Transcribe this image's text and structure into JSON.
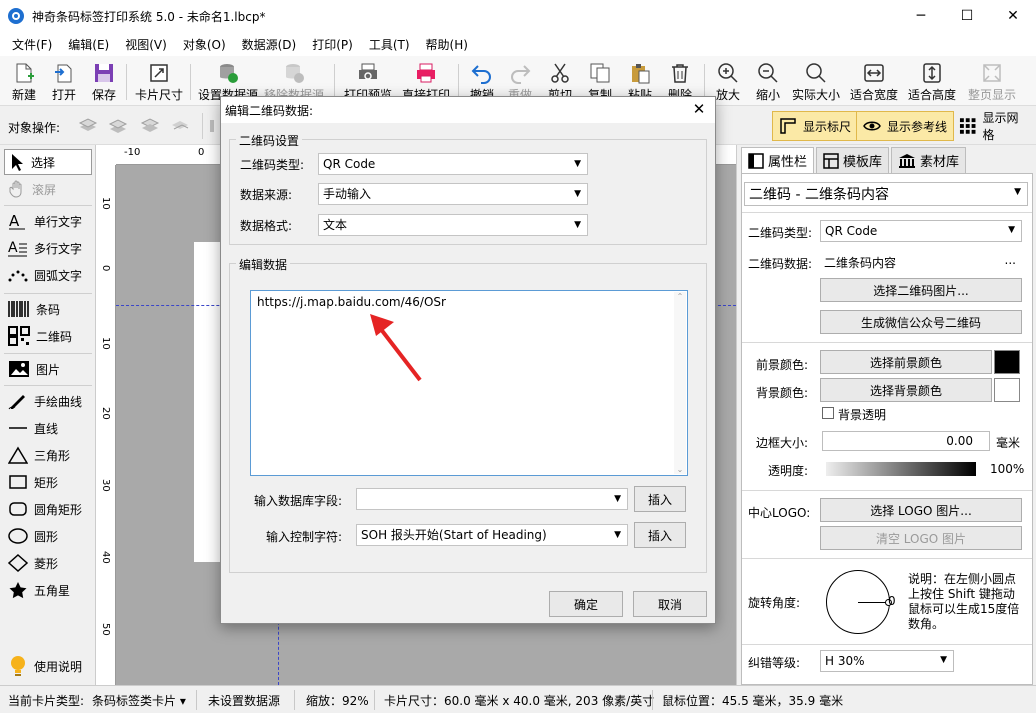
{
  "window": {
    "title": "神奇条码标签打印系统 5.0 - 未命名1.lbcp*",
    "minimize": "─",
    "maximize": "☐",
    "close": "✕"
  },
  "menu": [
    "文件(F)",
    "编辑(E)",
    "视图(V)",
    "对象(O)",
    "数据源(D)",
    "打印(P)",
    "工具(T)",
    "帮助(H)"
  ],
  "toolbar": {
    "new": "新建",
    "open": "打开",
    "save": "保存",
    "card_size": "卡片尺寸",
    "set_datasource": "设置数据源",
    "remove_datasource": "移除数据源",
    "print_preview": "打印预览",
    "direct_print": "直接打印",
    "undo": "撤销",
    "redo": "重做",
    "cut": "剪切",
    "copy": "复制",
    "paste": "粘贴",
    "delete": "删除",
    "zoom_in": "放大",
    "zoom_out": "缩小",
    "actual_size": "实际大小",
    "fit_width": "适合宽度",
    "fit_height": "适合高度",
    "fit_page": "整页显示"
  },
  "objbar": {
    "label": "对象操作:",
    "show_ruler": "显示标尺",
    "show_guides": "显示参考线",
    "show_grid": "显示网格"
  },
  "tools": {
    "select": "选择",
    "scroll": "滚屏",
    "single_text": "单行文字",
    "multi_text": "多行文字",
    "arc_text": "圆弧文字",
    "barcode": "条码",
    "qrcode": "二维码",
    "image": "图片",
    "freehand": "手绘曲线",
    "line": "直线",
    "triangle": "三角形",
    "rect": "矩形",
    "round_rect": "圆角矩形",
    "circle": "圆形",
    "diamond": "菱形",
    "star": "五角星",
    "manual": "使用说明"
  },
  "ruler": {
    "h": [
      "-10",
      "0"
    ],
    "v": [
      "0",
      "10",
      "0",
      "10",
      "20",
      "30",
      "40",
      "50"
    ]
  },
  "right_panel": {
    "tabs": [
      "属性栏",
      "模板库",
      "素材库"
    ],
    "object_select": "二维码 - 二维条码内容",
    "qr_type_label": "二维码类型:",
    "qr_type_value": "QR Code",
    "qr_data_label": "二维码数据:",
    "qr_data_value": "二维条码内容",
    "qr_data_more": "...",
    "select_qr_image": "选择二维码图片...",
    "gen_wechat": "生成微信公众号二维码",
    "fg_label": "前景颜色:",
    "fg_btn": "选择前景颜色",
    "bg_label": "背景颜色:",
    "bg_btn": "选择背景颜色",
    "bg_transparent": "背景透明",
    "border_label": "边框大小:",
    "border_value": "0.00",
    "border_unit": "毫米",
    "opacity_label": "透明度:",
    "opacity_value": "100%",
    "logo_label": "中心LOGO:",
    "logo_select": "选择 LOGO 图片...",
    "logo_clear": "清空  LOGO 图片",
    "rotate_label": "旋转角度:",
    "rotate_value": "0",
    "rotate_help": "说明：在左侧小圆点上按住 Shift 键拖动鼠标可以生成15度倍数角。",
    "ec_label": "纠错等级:",
    "ec_value": "H 30%",
    "fg_color": "#000000",
    "bg_color": "#ffffff"
  },
  "status": {
    "card_type_label": "当前卡片类型:",
    "card_type_value": "条码标签类卡片",
    "datasource": "未设置数据源",
    "zoom": "缩放：92%",
    "card_size": "卡片尺寸：60.0 毫米 x 40.0 毫米, 203 像素/英寸",
    "mouse_pos": "鼠标位置：45.5 毫米，35.9 毫米"
  },
  "dialog": {
    "title": "编辑二维码数据:",
    "settings_group": "二维码设置",
    "type_label": "二维码类型:",
    "type_value": "QR Code",
    "source_label": "数据来源:",
    "source_value": "手动输入",
    "format_label": "数据格式:",
    "format_value": "文本",
    "edit_group": "编辑数据",
    "data_text": "https://j.map.baidu.com/46/OSr",
    "db_field_label": "输入数据库字段:",
    "db_field_value": "",
    "db_insert": "插入",
    "ctrl_char_label": "输入控制字符:",
    "ctrl_char_value": "SOH  报头开始(Start of Heading)",
    "ctrl_insert": "插入",
    "ok": "确定",
    "cancel": "取消"
  }
}
